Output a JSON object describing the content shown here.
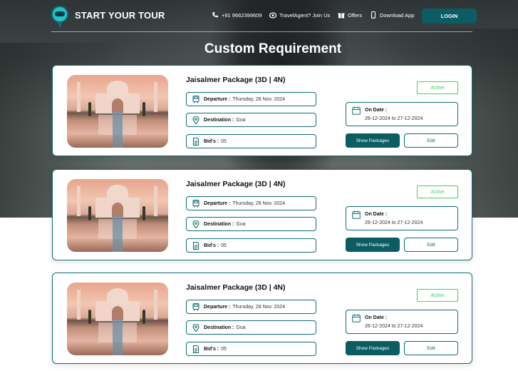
{
  "nav": {
    "brand": "START YOUR TOUR",
    "phone": "+91 9662399609",
    "agent": "TravelAgent? Join Us",
    "offers": "Offers",
    "download": "Download App",
    "login": "LOGIN"
  },
  "page": {
    "title": "Custom Requirement"
  },
  "labels": {
    "departure": "Departure :",
    "destination": "Destination :",
    "bids": "Bid's :",
    "on_date": "On Date :",
    "show_packages": "Show Packages",
    "edit": "Edit"
  },
  "cards": [
    {
      "title": "Jaisalmer Package  (3D | 4N)",
      "departure": "Thursday, 28 Nov. 2024",
      "destination": "Goa",
      "bids": "05",
      "status": "Active",
      "date_range": "26-12-2024 to 27-12-2024"
    },
    {
      "title": "Jaisalmer Package  (3D | 4N)",
      "departure": "Thursday, 28 Nov. 2024",
      "destination": "Goa",
      "bids": "05",
      "status": "Active",
      "date_range": "26-12-2024 to 27-12-2024"
    },
    {
      "title": "Jaisalmer Package  (3D | 4N)",
      "departure": "Thursday, 28 Nov. 2024",
      "destination": "Goa",
      "bids": "05",
      "status": "Active",
      "date_range": "26-12-2024 to 27-12-2024"
    }
  ],
  "colors": {
    "primary": "#0b5d63",
    "active": "#3fd45a",
    "border": "#0f6d73"
  },
  "icons": [
    "phone-icon",
    "agent-icon",
    "gift-icon",
    "mobile-icon",
    "train-icon",
    "location-icon",
    "document-icon",
    "calendar-icon"
  ]
}
